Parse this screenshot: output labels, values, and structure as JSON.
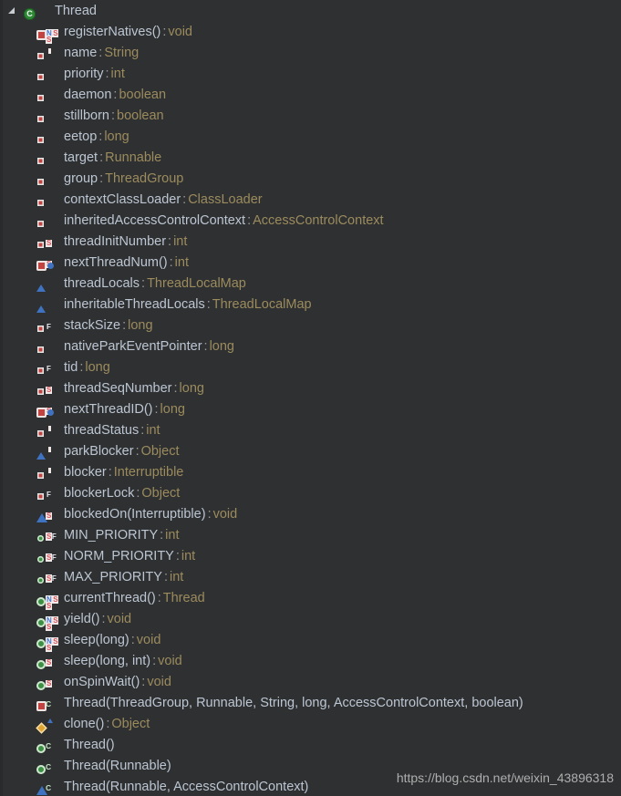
{
  "panel": {
    "name": "structure-tree-panel",
    "background": "#2f3032",
    "colors": {
      "member_name": "#bcc6d2",
      "member_type": "#9b8b5d",
      "separator": "#9a9a9a",
      "public": "#3d8f44",
      "private": "#c2433f",
      "protected": "#e0a531",
      "package_private": "#3f72c0"
    }
  },
  "root": {
    "toggle_icon": "collapse-triangle-icon",
    "icon": "java-class-icon",
    "label": "Thread"
  },
  "watermark": "https://blog.csdn.net/weixin_43896318",
  "members": [
    {
      "icon": "private-method-icon",
      "badges": [
        "native",
        "static"
      ],
      "name": "registerNatives()",
      "sep": ":",
      "type": "void"
    },
    {
      "icon": "private-field-icon",
      "badges": [
        "volatile"
      ],
      "name": "name",
      "sep": ":",
      "type": "String"
    },
    {
      "icon": "private-field-icon",
      "badges": [],
      "name": "priority",
      "sep": ":",
      "type": "int"
    },
    {
      "icon": "private-field-icon",
      "badges": [],
      "name": "daemon",
      "sep": ":",
      "type": "boolean"
    },
    {
      "icon": "private-field-icon",
      "badges": [],
      "name": "stillborn",
      "sep": ":",
      "type": "boolean"
    },
    {
      "icon": "private-field-icon",
      "badges": [],
      "name": "eetop",
      "sep": ":",
      "type": "long"
    },
    {
      "icon": "private-field-icon",
      "badges": [],
      "name": "target",
      "sep": ":",
      "type": "Runnable"
    },
    {
      "icon": "private-field-icon",
      "badges": [],
      "name": "group",
      "sep": ":",
      "type": "ThreadGroup"
    },
    {
      "icon": "private-field-icon",
      "badges": [],
      "name": "contextClassLoader",
      "sep": ":",
      "type": "ClassLoader"
    },
    {
      "icon": "private-field-icon",
      "badges": [],
      "name": "inheritedAccessControlContext",
      "sep": ":",
      "type": "AccessControlContext"
    },
    {
      "icon": "private-field-icon",
      "badges": [
        "static"
      ],
      "name": "threadInitNumber",
      "sep": ":",
      "type": "int"
    },
    {
      "icon": "private-method-icon",
      "badges": [
        "static",
        "synchronized"
      ],
      "name": "nextThreadNum()",
      "sep": ":",
      "type": "int"
    },
    {
      "icon": "package-private-field-icon",
      "badges": [],
      "name": "threadLocals",
      "sep": ":",
      "type": "ThreadLocalMap"
    },
    {
      "icon": "package-private-field-icon",
      "badges": [],
      "name": "inheritableThreadLocals",
      "sep": ":",
      "type": "ThreadLocalMap"
    },
    {
      "icon": "private-field-icon",
      "badges": [
        "final"
      ],
      "name": "stackSize",
      "sep": ":",
      "type": "long"
    },
    {
      "icon": "private-field-icon",
      "badges": [],
      "name": "nativeParkEventPointer",
      "sep": ":",
      "type": "long"
    },
    {
      "icon": "private-field-icon",
      "badges": [
        "final"
      ],
      "name": "tid",
      "sep": ":",
      "type": "long"
    },
    {
      "icon": "private-field-icon",
      "badges": [
        "static"
      ],
      "name": "threadSeqNumber",
      "sep": ":",
      "type": "long"
    },
    {
      "icon": "private-method-icon",
      "badges": [
        "static",
        "synchronized"
      ],
      "name": "nextThreadID()",
      "sep": ":",
      "type": "long"
    },
    {
      "icon": "private-field-icon",
      "badges": [
        "volatile"
      ],
      "name": "threadStatus",
      "sep": ":",
      "type": "int"
    },
    {
      "icon": "package-private-field-icon",
      "badges": [
        "volatile"
      ],
      "name": "parkBlocker",
      "sep": ":",
      "type": "Object"
    },
    {
      "icon": "private-field-icon",
      "badges": [
        "volatile"
      ],
      "name": "blocker",
      "sep": ":",
      "type": "Interruptible"
    },
    {
      "icon": "private-field-icon",
      "badges": [
        "final"
      ],
      "name": "blockerLock",
      "sep": ":",
      "type": "Object"
    },
    {
      "icon": "package-private-method-icon",
      "badges": [
        "static"
      ],
      "name": "blockedOn(Interruptible)",
      "sep": ":",
      "type": "void"
    },
    {
      "icon": "public-field-icon",
      "badges": [
        "static-final"
      ],
      "name": "MIN_PRIORITY",
      "sep": ":",
      "type": "int"
    },
    {
      "icon": "public-field-icon",
      "badges": [
        "static-final"
      ],
      "name": "NORM_PRIORITY",
      "sep": ":",
      "type": "int"
    },
    {
      "icon": "public-field-icon",
      "badges": [
        "static-final"
      ],
      "name": "MAX_PRIORITY",
      "sep": ":",
      "type": "int"
    },
    {
      "icon": "public-method-icon",
      "badges": [
        "native",
        "static"
      ],
      "name": "currentThread()",
      "sep": ":",
      "type": "Thread"
    },
    {
      "icon": "public-method-icon",
      "badges": [
        "native",
        "static"
      ],
      "name": "yield()",
      "sep": ":",
      "type": "void"
    },
    {
      "icon": "public-method-icon",
      "badges": [
        "native",
        "static"
      ],
      "name": "sleep(long)",
      "sep": ":",
      "type": "void"
    },
    {
      "icon": "public-method-icon",
      "badges": [
        "static"
      ],
      "name": "sleep(long, int)",
      "sep": ":",
      "type": "void"
    },
    {
      "icon": "public-method-icon",
      "badges": [
        "static"
      ],
      "name": "onSpinWait()",
      "sep": ":",
      "type": "void"
    },
    {
      "icon": "private-method-icon",
      "badges": [
        "constructor"
      ],
      "name": "Thread(ThreadGroup, Runnable, String, long, AccessControlContext, boolean)",
      "sep": "",
      "type": ""
    },
    {
      "icon": "protected-method-icon",
      "badges": [
        "overriding"
      ],
      "name": "clone()",
      "sep": ":",
      "type": "Object"
    },
    {
      "icon": "public-method-icon",
      "badges": [
        "constructor"
      ],
      "name": "Thread()",
      "sep": "",
      "type": ""
    },
    {
      "icon": "public-method-icon",
      "badges": [
        "constructor"
      ],
      "name": "Thread(Runnable)",
      "sep": "",
      "type": ""
    },
    {
      "icon": "package-private-method-icon",
      "badges": [
        "constructor"
      ],
      "name": "Thread(Runnable, AccessControlContext)",
      "sep": "",
      "type": ""
    }
  ]
}
